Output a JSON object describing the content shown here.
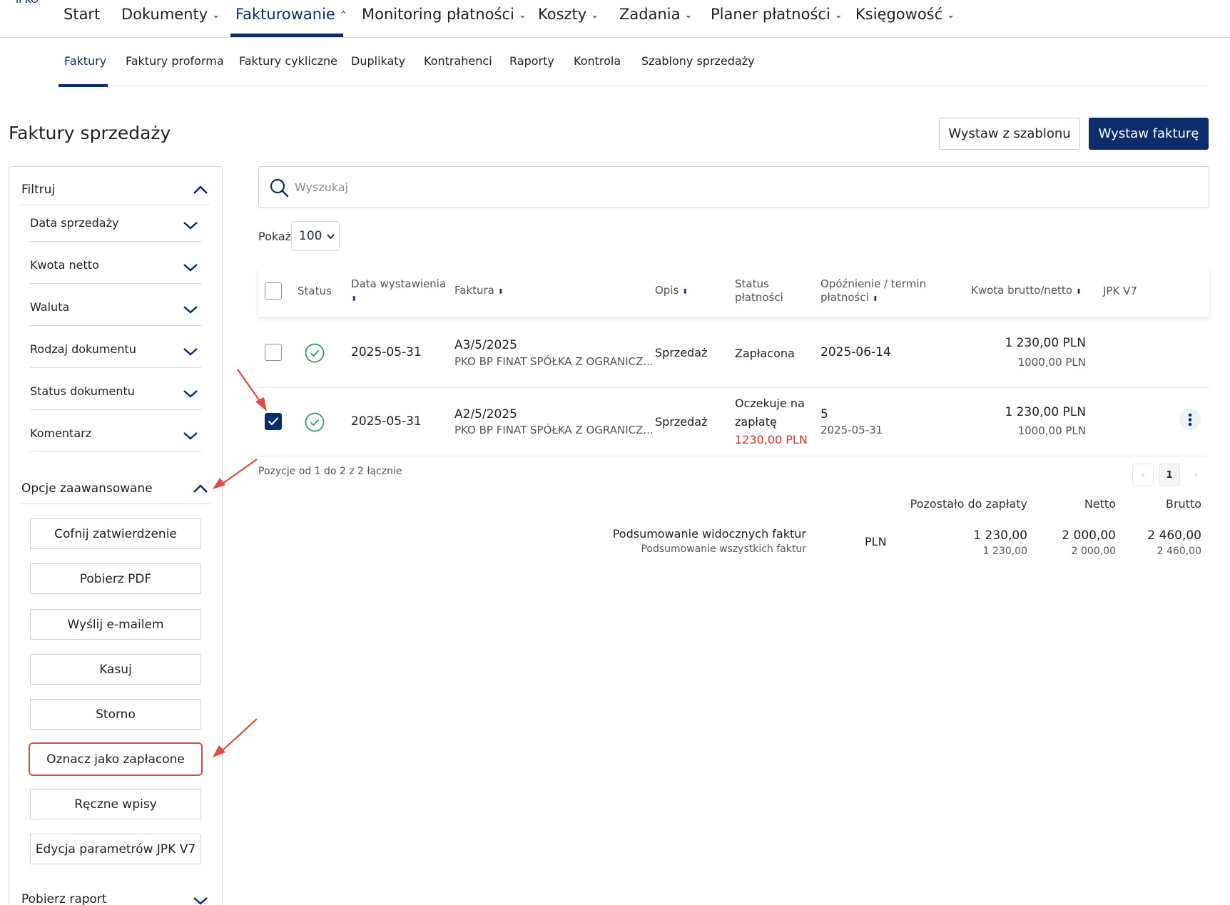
{
  "brand": "IPKO",
  "nav": {
    "items": [
      {
        "label": "Start",
        "chev": ""
      },
      {
        "label": "Dokumenty",
        "chev": "⌄"
      },
      {
        "label": "Fakturowanie",
        "chev": "⌃"
      },
      {
        "label": "Monitoring płatności",
        "chev": "⌄"
      },
      {
        "label": "Koszty",
        "chev": "⌄"
      },
      {
        "label": "Zadania",
        "chev": "⌄"
      },
      {
        "label": "Planer płatności",
        "chev": "⌄"
      },
      {
        "label": "Księgowość",
        "chev": "⌄"
      }
    ]
  },
  "subnav": {
    "items": [
      "Faktury",
      "Faktury proforma",
      "Faktury cykliczne",
      "Duplikaty",
      "Kontrahenci",
      "Raporty",
      "Kontrola",
      "Szablony sprzedaży"
    ]
  },
  "page": {
    "title": "Faktury sprzedaży",
    "template_button": "Wystaw z szablonu",
    "issue_button": "Wystaw fakturę"
  },
  "filters": {
    "title": "Filtruj",
    "items": [
      "Data sprzedaży",
      "Kwota netto",
      "Waluta",
      "Rodzaj dokumentu",
      "Status dokumentu",
      "Komentarz"
    ]
  },
  "advanced": {
    "title": "Opcje zaawansowane",
    "buttons": [
      "Cofnij zatwierdzenie",
      "Pobierz PDF",
      "Wyślij e-mailem",
      "Kasuj",
      "Storno",
      "Oznacz jako zapłacone",
      "Ręczne wpisy",
      "Edycja parametrów JPK V7"
    ]
  },
  "report": {
    "title": "Pobierz raport"
  },
  "search": {
    "placeholder": "Wyszukaj"
  },
  "show": {
    "label": "Pokaż",
    "value": "100"
  },
  "table": {
    "headers": {
      "status": "Status",
      "issue_date": "Data wystawienia",
      "invoice": "Faktura",
      "desc": "Opis",
      "payment_status_1": "Status",
      "payment_status_2": "płatności",
      "delay_1": "Opóźnienie / termin",
      "delay_2": "płatności",
      "amount": "Kwota brutto/netto",
      "jpk": "JPK V7",
      "sort_icon": "⬍"
    },
    "rows": [
      {
        "checked": false,
        "issue_date": "2025-05-31",
        "invoice_no": "A3/5/2025",
        "client": "PKO BP FINAT SPÓŁKA Z OGRANICZ...",
        "desc": "Sprzedaż",
        "payment_status": "Zapłacona",
        "delay": "2025-06-14",
        "gross": "1 230,00 PLN",
        "net": "1000,00 PLN"
      },
      {
        "checked": true,
        "issue_date": "2025-05-31",
        "invoice_no": "A2/5/2025",
        "client": "PKO BP FINAT SPÓŁKA Z OGRANICZ...",
        "desc": "Sprzedaż",
        "payment_status_1": "Oczekuje na",
        "payment_status_2": "zapłatę",
        "payment_due_amount": "1230,00 PLN",
        "delay_days": "5",
        "delay_date": "2025-05-31",
        "gross": "1 230,00 PLN",
        "net": "1000,00 PLN"
      }
    ],
    "positions": "Pozycje od 1 do 2 z 2 łącznie",
    "pager": {
      "prev": "‹",
      "current": "1",
      "next": "›"
    }
  },
  "summary": {
    "col_remaining": "Pozostało do zapłaty",
    "col_net": "Netto",
    "col_gross": "Brutto",
    "visible_label": "Podsumowanie widocznych faktur",
    "all_label": "Podsumowanie wszystkich faktur",
    "currency": "PLN",
    "visible_remaining": "1 230,00",
    "visible_net": "2 000,00",
    "visible_gross": "2 460,00",
    "all_remaining": "1 230,00",
    "all_net": "2 000,00",
    "all_gross": "2 460,00"
  },
  "colors": {
    "brand": "#0b2d6b",
    "accent_red": "#e44a3c",
    "success": "#2e9e5b"
  }
}
